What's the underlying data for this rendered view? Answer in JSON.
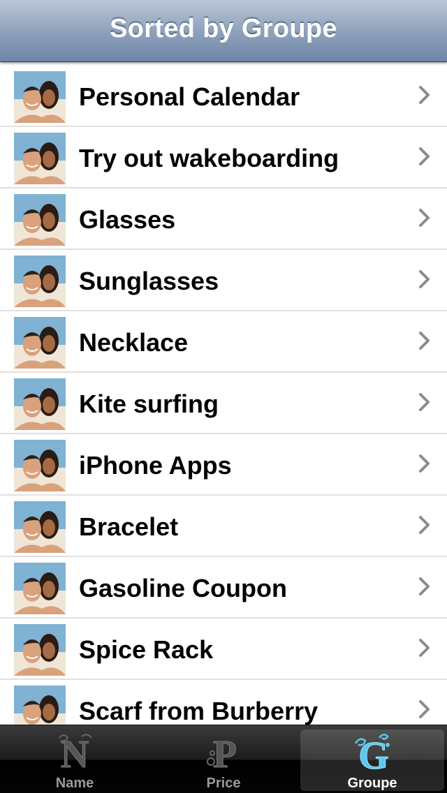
{
  "navbar": {
    "title": "Sorted by Groupe"
  },
  "list": {
    "thumbnail_icon": "couple-photo-icon",
    "accessory_icon": "chevron-right-icon",
    "items": [
      {
        "label": "Personal Calendar"
      },
      {
        "label": "Try out wakeboarding"
      },
      {
        "label": "Glasses"
      },
      {
        "label": "Sunglasses"
      },
      {
        "label": "Necklace"
      },
      {
        "label": "Kite surfing"
      },
      {
        "label": "iPhone Apps"
      },
      {
        "label": "Bracelet"
      },
      {
        "label": "Gasoline Coupon"
      },
      {
        "label": "Spice Rack"
      },
      {
        "label": "Scarf from Burberry"
      }
    ]
  },
  "tabbar": {
    "tabs": [
      {
        "label": "Name",
        "icon": "letter-n-icon",
        "selected": false
      },
      {
        "label": "Price",
        "icon": "letter-p-icon",
        "selected": false
      },
      {
        "label": "Groupe",
        "icon": "letter-g-icon",
        "selected": true
      }
    ]
  },
  "colors": {
    "navbar_top": "#b9c6d6",
    "navbar_bottom": "#6d86a6",
    "row_separator": "#e0e0e0",
    "chevron": "#8c8c8c",
    "tabbar_background": "#1c1c1c",
    "tab_selected_icon": "#5bc8ef",
    "tab_unselected_label": "#9a9a9a"
  }
}
